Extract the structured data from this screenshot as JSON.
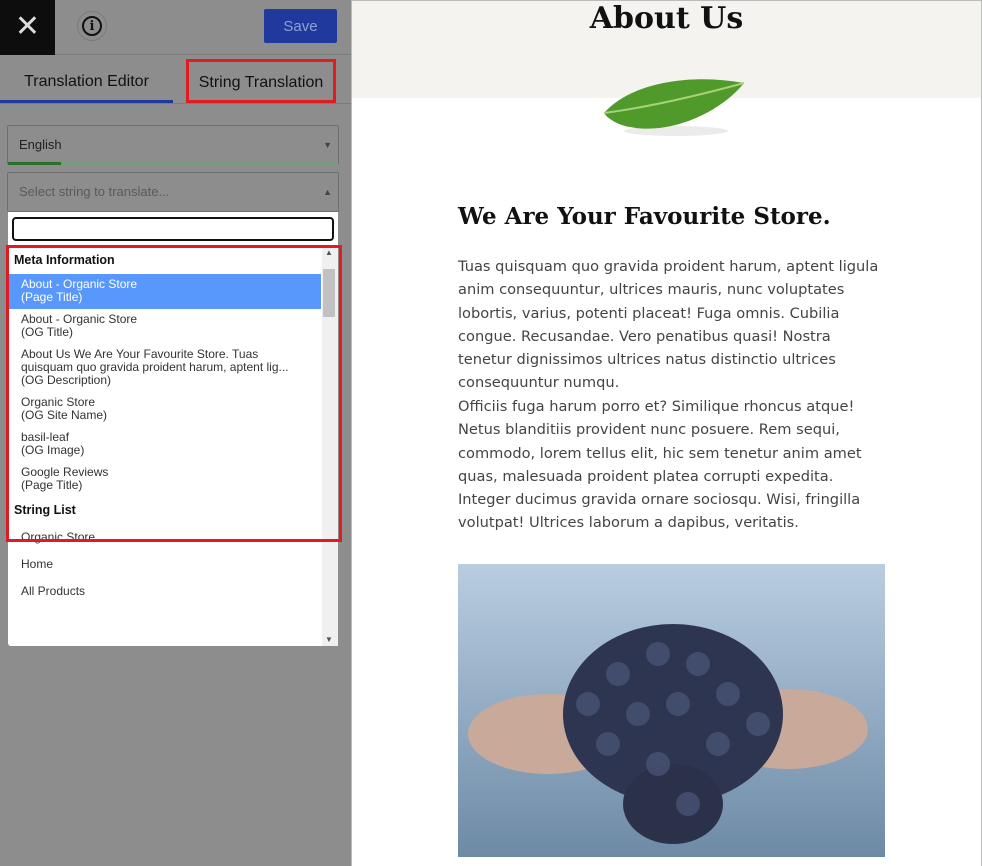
{
  "toolbar": {
    "close_icon": "close-icon",
    "info_icon": "info-icon",
    "save_label": "Save",
    "save_color": "#1f3a9c"
  },
  "tabs": [
    {
      "label": "Translation Editor",
      "active": true
    },
    {
      "label": "String Translation",
      "highlighted": true
    }
  ],
  "language_select": {
    "value": "English",
    "progress_percent": 16
  },
  "string_select": {
    "placeholder": "Select string to translate...",
    "search_value": ""
  },
  "dropdown": {
    "meta_group": "Meta Information",
    "meta_items": [
      {
        "text": "About - Organic Store",
        "type": "(Page Title)",
        "selected": true
      },
      {
        "text": "About - Organic Store",
        "type": "(OG Title)"
      },
      {
        "text": "About Us We Are Your Favourite Store. Tuas quisquam quo gravida proident harum, aptent lig...",
        "type": "(OG Description)"
      },
      {
        "text": "Organic Store",
        "type": "(OG Site Name)"
      },
      {
        "text": "basil-leaf",
        "type": "(OG Image)"
      },
      {
        "text": "Google Reviews",
        "type": "(Page Title)"
      }
    ],
    "string_group": "String List",
    "string_items": [
      "Organic Store",
      "Home",
      "All Products"
    ]
  },
  "preview": {
    "title": "About Us",
    "heading": "We Are Your Favourite Store.",
    "paragraph1": "Tuas quisquam quo gravida proident harum, aptent ligula anim consequuntur, ultrices mauris, nunc voluptates lobortis, varius, potenti placeat! Fuga omnis. Cubilia congue. Recusandae. Vero penatibus quasi! Nostra tenetur dignissimos ultrices natus distinctio ultrices consequuntur numqu.",
    "paragraph2": "Officiis fuga harum porro et? Similique rhoncus atque! Netus blanditiis provident nunc posuere. Rem sequi, commodo, lorem tellus elit, hic sem tenetur anim amet quas, malesuada proident platea corrupti expedita.",
    "paragraph3": "Integer ducimus gravida ornare sociosqu. Wisi, fringilla volutpat! Ultrices laborum a dapibus, veritatis.",
    "highlight_color": "#e01b22"
  }
}
